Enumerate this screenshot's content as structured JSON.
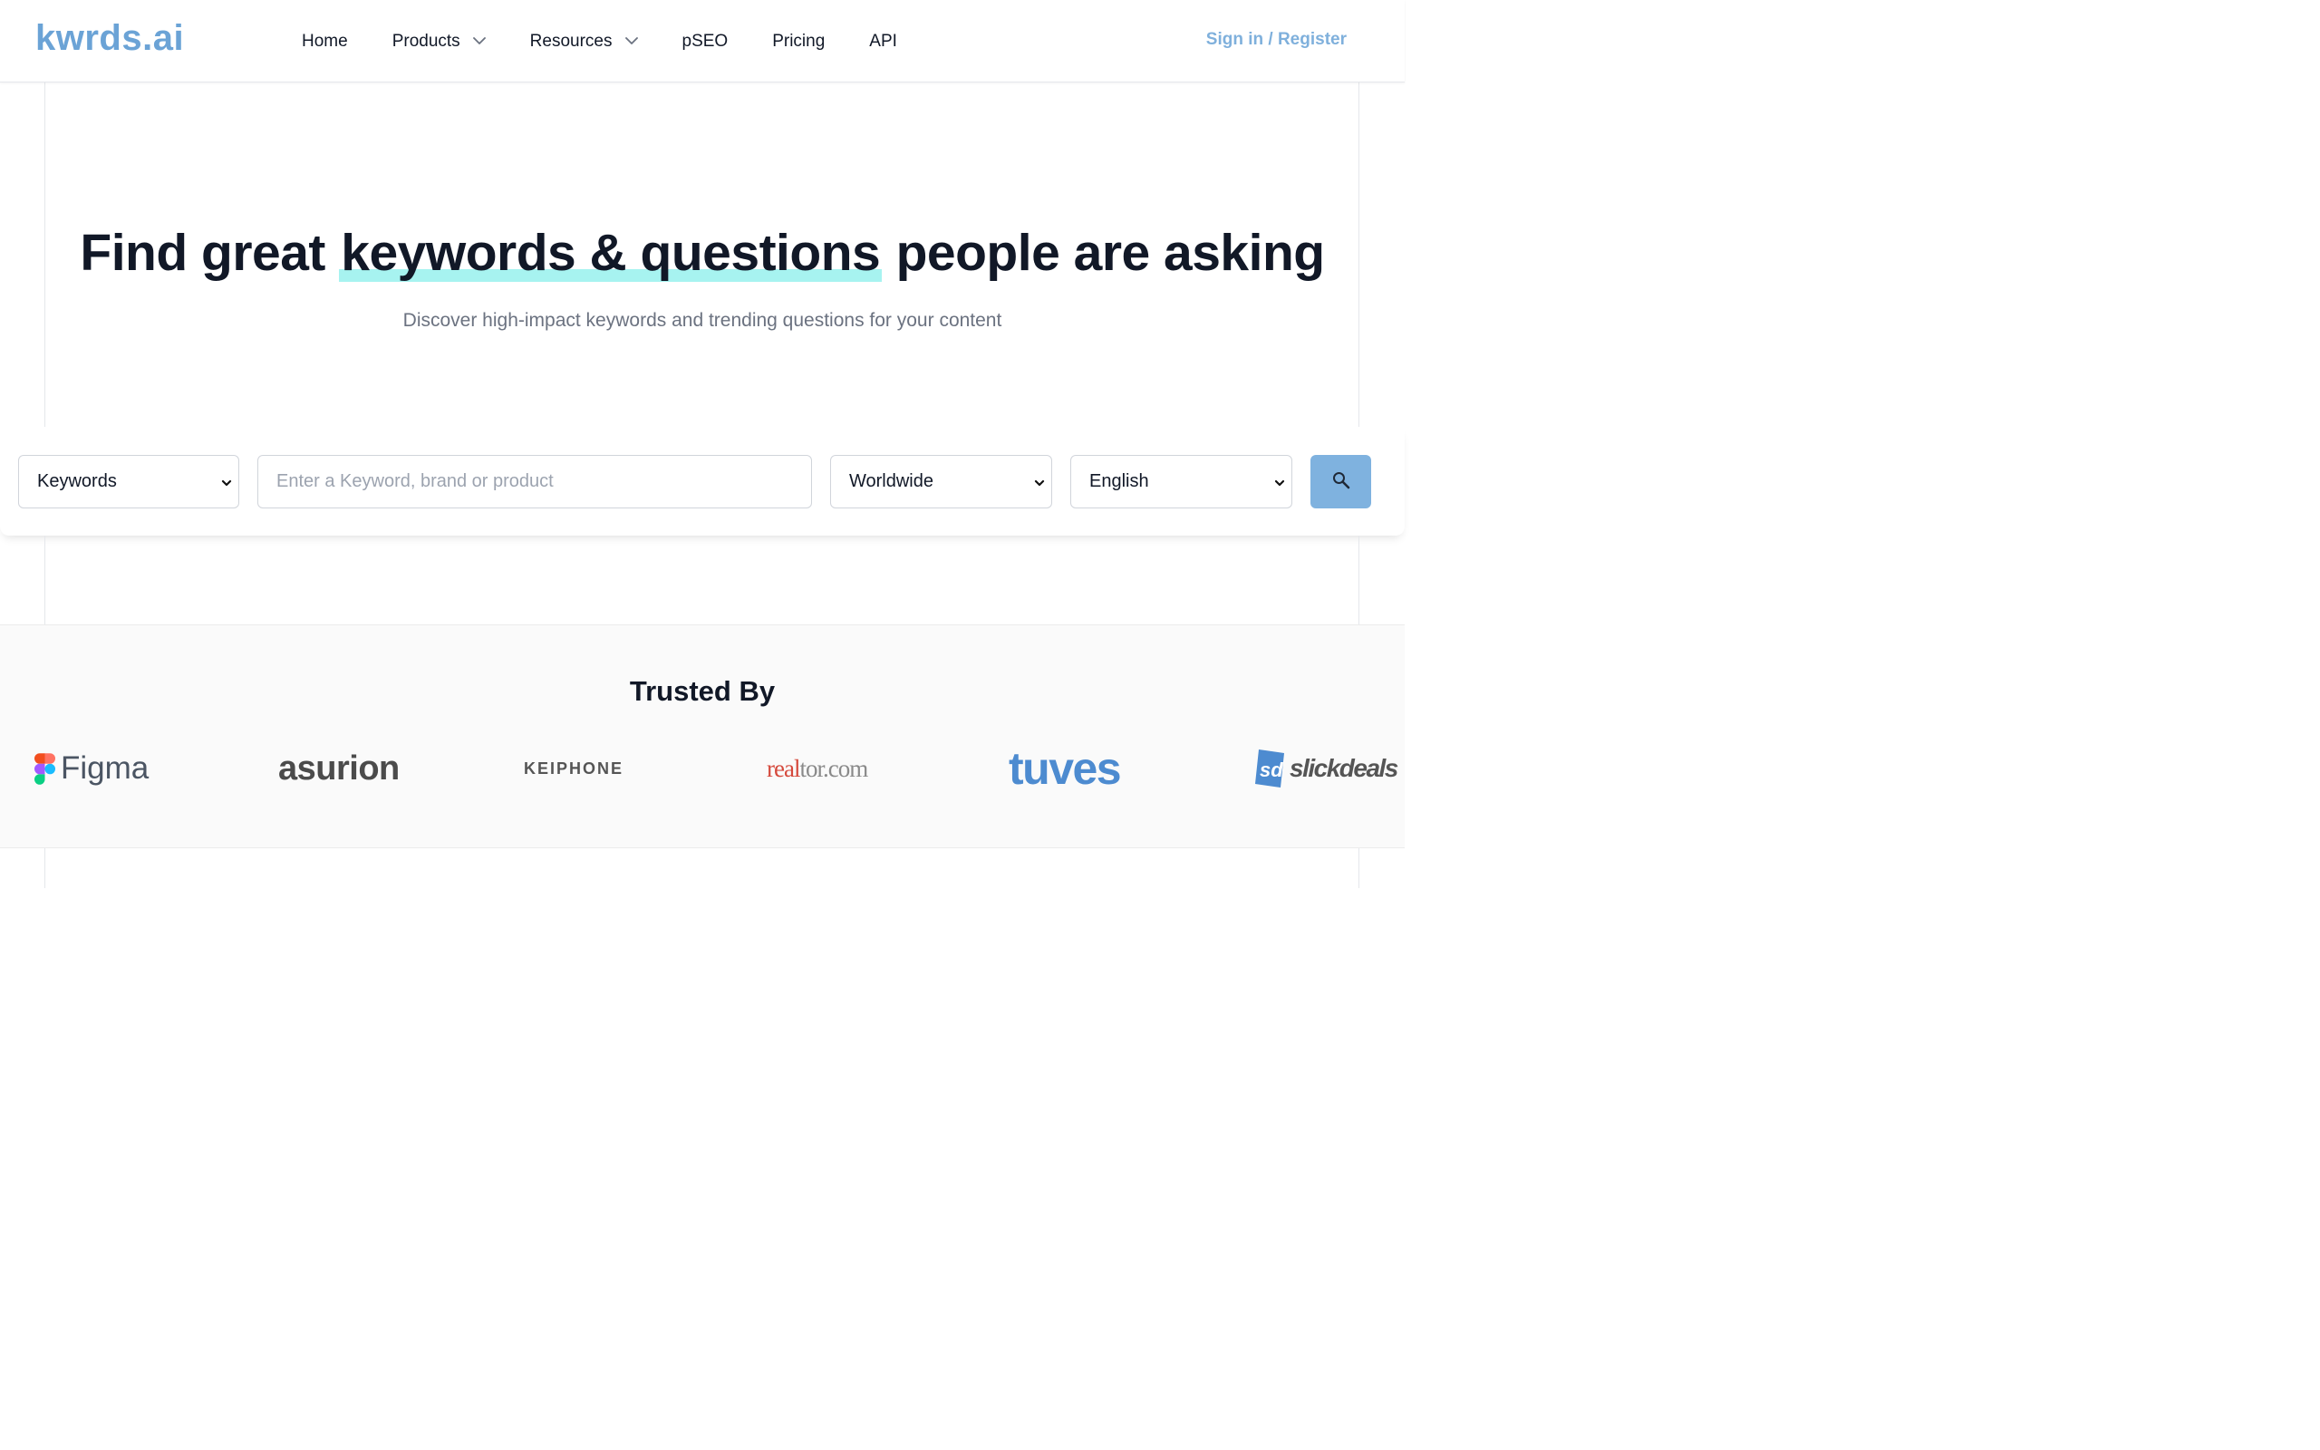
{
  "header": {
    "logo": "kwrds.ai",
    "nav": [
      {
        "label": "Home",
        "dropdown": false
      },
      {
        "label": "Products",
        "dropdown": true
      },
      {
        "label": "Resources",
        "dropdown": true
      },
      {
        "label": "pSEO",
        "dropdown": false
      },
      {
        "label": "Pricing",
        "dropdown": false
      },
      {
        "label": "API",
        "dropdown": false
      }
    ],
    "signin": "Sign in / Register"
  },
  "hero": {
    "title_pre": "Find great ",
    "title_highlight": "keywords & questions",
    "title_post": " people are asking",
    "subtitle": "Discover high-impact keywords and trending questions for your content"
  },
  "search": {
    "type_value": "Keywords",
    "placeholder": "Enter a Keyword, brand or product",
    "value": "",
    "country_value": "Worldwide",
    "language_value": "English",
    "button_icon": "search-icon"
  },
  "trusted": {
    "title": "Trusted By",
    "logos": [
      {
        "name": "Figma",
        "text": "Figma"
      },
      {
        "name": "asurion",
        "text": "asurion"
      },
      {
        "name": "KEIPHONE",
        "text": "KEIPHONE"
      },
      {
        "name": "realtor.com",
        "text_red": "real",
        "text_gray": "tor.com"
      },
      {
        "name": "tuves",
        "text": "tuves"
      },
      {
        "name": "slickdeals",
        "mark": "sd",
        "text": "slickdeals"
      }
    ]
  },
  "colors": {
    "brand": "#6ba3d6",
    "highlight": "#a7f3f0",
    "search_button": "#7fb2df",
    "heading": "#111827",
    "muted": "#6b7280"
  }
}
